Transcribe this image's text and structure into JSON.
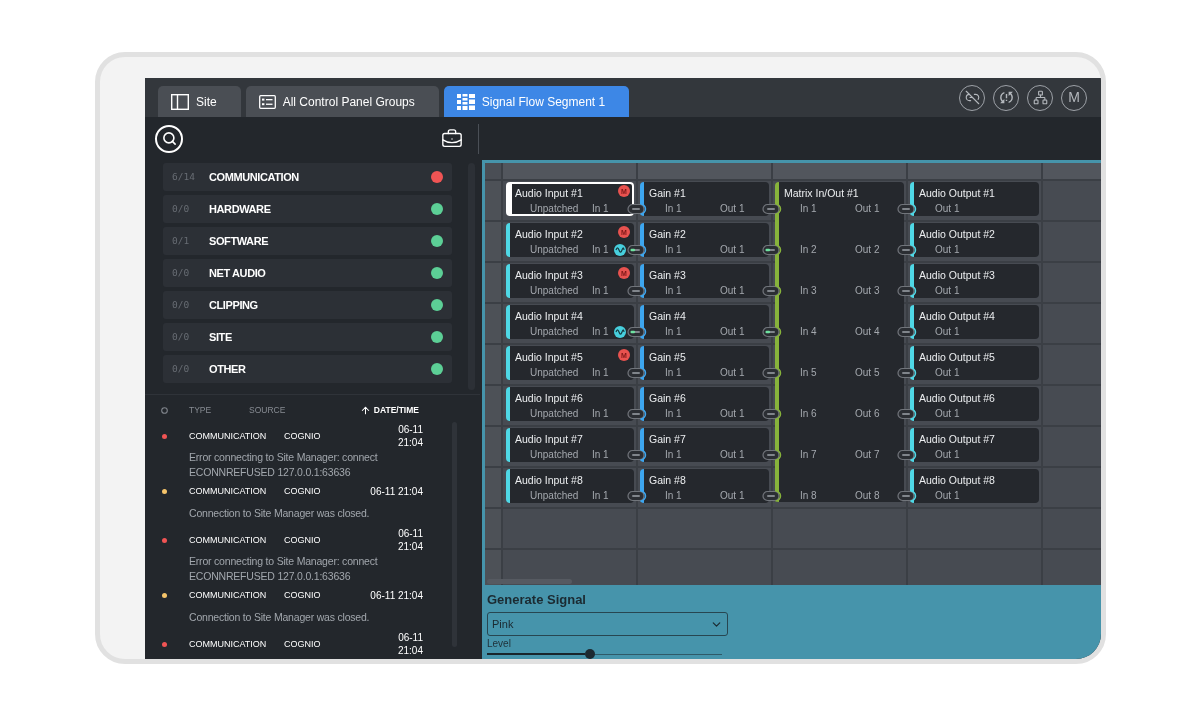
{
  "tabs": [
    {
      "label": "Site",
      "selected": false
    },
    {
      "label": "All Control Panel Groups",
      "selected": false
    },
    {
      "label": "Signal Flow Segment 1",
      "selected": true
    }
  ],
  "header_actions": {
    "letter_button": "M"
  },
  "alert_categories": [
    {
      "count": "6/14",
      "label": "COMMUNICATION",
      "color": "#f05454"
    },
    {
      "count": "0/0",
      "label": "HARDWARE",
      "color": "#5ccf96"
    },
    {
      "count": "0/1",
      "label": "SOFTWARE",
      "color": "#5ccf96"
    },
    {
      "count": "0/0",
      "label": "NET AUDIO",
      "color": "#5ccf96"
    },
    {
      "count": "0/0",
      "label": "CLIPPING",
      "color": "#5ccf96"
    },
    {
      "count": "0/0",
      "label": "SITE",
      "color": "#5ccf96"
    },
    {
      "count": "0/0",
      "label": "OTHER",
      "color": "#5ccf96"
    }
  ],
  "event_log": {
    "columns": [
      {
        "label": "TYPE",
        "sorted": false
      },
      {
        "label": "SOURCE",
        "sorted": false
      },
      {
        "label": "DATE/TIME",
        "sorted": true
      }
    ],
    "rows": [
      {
        "kind": "error",
        "color": "#f05454",
        "type": "COMMUNICATION",
        "source": "COGNIO",
        "date_time": "06-11 21:04",
        "message": "Error connecting to Site Manager: connect ECONNREFUSED 127.0.0.1:63636"
      },
      {
        "kind": "notice",
        "color": "#f5c46a",
        "type": "COMMUNICATION",
        "source": "COGNIO",
        "date_time": "06-11 21:04",
        "message": "Connection to Site Manager was closed."
      },
      {
        "kind": "error",
        "color": "#f05454",
        "type": "COMMUNICATION",
        "source": "COGNIO",
        "date_time": "06-11 21:04",
        "message": "Error connecting to Site Manager: connect ECONNREFUSED 127.0.0.1:63636"
      },
      {
        "kind": "notice",
        "color": "#f5c46a",
        "type": "COMMUNICATION",
        "source": "COGNIO",
        "date_time": "06-11 21:04",
        "message": "Connection to Site Manager was closed."
      },
      {
        "kind": "error",
        "color": "#f05454",
        "type": "COMMUNICATION",
        "source": "COGNIO",
        "date_time": "06-11 21:04"
      }
    ]
  },
  "signal_flow": {
    "inputs": [
      {
        "title": "Audio Input #1",
        "status": "Unpatched",
        "port": "In 1",
        "badge": "M",
        "generating": false,
        "selected": true
      },
      {
        "title": "Audio Input #2",
        "status": "Unpatched",
        "port": "In 1",
        "badge": "M",
        "generating": true,
        "selected": false
      },
      {
        "title": "Audio Input #3",
        "status": "Unpatched",
        "port": "In 1",
        "badge": "M",
        "generating": false,
        "selected": false
      },
      {
        "title": "Audio Input #4",
        "status": "Unpatched",
        "port": "In 1",
        "generating": true,
        "selected": false
      },
      {
        "title": "Audio Input #5",
        "status": "Unpatched",
        "port": "In 1",
        "badge": "M",
        "generating": false,
        "selected": false
      },
      {
        "title": "Audio Input #6",
        "status": "Unpatched",
        "port": "In 1",
        "generating": false,
        "selected": false
      },
      {
        "title": "Audio Input #7",
        "status": "Unpatched",
        "port": "In 1",
        "generating": false,
        "selected": false
      },
      {
        "title": "Audio Input #8",
        "status": "Unpatched",
        "port": "In 1",
        "generating": false,
        "selected": false
      }
    ],
    "gains": [
      {
        "title": "Gain #1",
        "input": "In 1",
        "output": "Out 1",
        "selected": false
      },
      {
        "title": "Gain #2",
        "input": "In 1",
        "output": "Out 1",
        "selected": false
      },
      {
        "title": "Gain #3",
        "input": "In 1",
        "output": "Out 1",
        "selected": false
      },
      {
        "title": "Gain #4",
        "input": "In 1",
        "output": "Out 1",
        "selected": false
      },
      {
        "title": "Gain #5",
        "input": "In 1",
        "output": "Out 1",
        "selected": false
      },
      {
        "title": "Gain #6",
        "input": "In 1",
        "output": "Out 1",
        "selected": false
      },
      {
        "title": "Gain #7",
        "input": "In 1",
        "output": "Out 1",
        "selected": false
      },
      {
        "title": "Gain #8",
        "input": "In 1",
        "output": "Out 1",
        "selected": false
      }
    ],
    "matrix": {
      "title": "Matrix In/Out #1",
      "selected": false,
      "ports": [
        {
          "input": "In 1",
          "output": "Out 1"
        },
        {
          "input": "In 2",
          "output": "Out 2"
        },
        {
          "input": "In 3",
          "output": "Out 3"
        },
        {
          "input": "In 4",
          "output": "Out 4"
        },
        {
          "input": "In 5",
          "output": "Out 5"
        },
        {
          "input": "In 6",
          "output": "Out 6"
        },
        {
          "input": "In 7",
          "output": "Out 7"
        },
        {
          "input": "In 8",
          "output": "Out 8"
        }
      ]
    },
    "outputs": [
      {
        "title": "Audio Output #1",
        "port": "Out 1",
        "selected": false
      },
      {
        "title": "Audio Output #2",
        "port": "Out 1",
        "selected": false
      },
      {
        "title": "Audio Output #3",
        "port": "Out 1",
        "selected": false
      },
      {
        "title": "Audio Output #4",
        "port": "Out 1",
        "selected": false
      },
      {
        "title": "Audio Output #5",
        "port": "Out 1",
        "selected": false
      },
      {
        "title": "Audio Output #6",
        "port": "Out 1",
        "selected": false
      },
      {
        "title": "Audio Output #7",
        "port": "Out 1",
        "selected": false
      },
      {
        "title": "Audio Output #8",
        "port": "Out 1",
        "selected": false
      }
    ]
  },
  "generate_signal": {
    "title": "Generate Signal",
    "signal_type": "Pink",
    "level_label": "Level",
    "level": 0.44
  }
}
